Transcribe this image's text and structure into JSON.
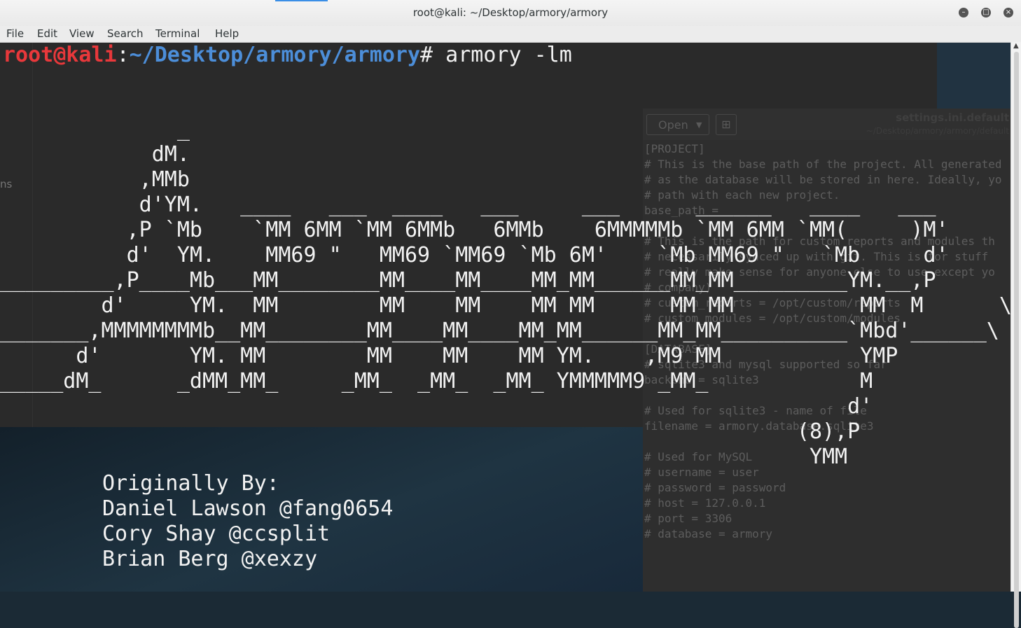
{
  "window": {
    "title": "root@kali: ~/Desktop/armory/armory",
    "controls": [
      "minimize",
      "maximize",
      "close"
    ]
  },
  "menubar": {
    "items": [
      "File",
      "Edit",
      "View",
      "Search",
      "Terminal",
      "Help"
    ]
  },
  "terminal": {
    "prompt": {
      "user_host": "root@kali",
      "colon": ":",
      "path": "~/Desktop/armory/armory",
      "symbol": "#",
      "command": " armory -lm"
    },
    "ascii_art": [
      "              _",
      "            dM.",
      "           ,MMb",
      "           d'YM.   ____   ___  ____   ___     ___      ______   ____   ___",
      "          ,P `Mb    `MM 6MM `MM 6MMb   6MMb    6MMMMMb `MM 6MM `MM(     )M'",
      "          d'  YM.    MM69 \"   MM69 `MM69 `Mb 6M'    `Mb MM69 \"   `Mb     d'",
      "_________,P____Mb___MM________MM____MM____MM_MM______MM_MM_________YM.__,P",
      "        d'     YM.  MM        MM    MM    MM MM      MM MM          MM  M      \\",
      "_______,MMMMMMMMb__MM________MM____MM____MM_MM______MM_MM__________`Mbd'______\\",
      "      d'       YM. MM        MM    MM    MM YM.    ,M9 MM           YMP",
      "_____dM_      _dMM_MM_     _MM_  _MM_  _MM_ YMMMMM9 _MM_            M",
      "                                                                   d'",
      "                                                               (8),P",
      "                                                                YMM"
    ],
    "credits": [
      "Originally By:",
      "Daniel Lawson @fang0654",
      "Cory Shay @ccsplit",
      "Brian Berg @xexzy"
    ],
    "background_sidebar_fragment": "ns"
  },
  "editor_behind": {
    "open_button": "Open",
    "filename": "settings.ini.default",
    "path": "~/Desktop/armory/armory/default",
    "lines": [
      "[PROJECT]",
      "# This is the base path of the project. All generated",
      "# as the database will be stored in here. Ideally, yo",
      "# path with each new project.",
      "base_path = ",
      "",
      "# This is the path for custom reports and modules th",
      "# necessarily synced up with git. This is for stuff",
      "# really make sense for anyone else to use except yo",
      "# company)",
      "# custom_reports = /opt/custom/reports",
      "# custom_modules = /opt/custom/modules",
      "",
      "[DATABASE]",
      "# sqlite3 and mysql supported so far",
      "backend = sqlite3",
      "",
      "# Used for sqlite3 - name of file",
      "filename = armory.database.sqlite3",
      "",
      "# Used for MySQL",
      "# username = user",
      "# password = password",
      "# host = 127.0.0.1",
      "# port = 3306",
      "# database = armory"
    ]
  },
  "colors": {
    "prompt_user": "#e8383b",
    "prompt_path": "#4c8ed9",
    "terminal_text": "#f2f2f2"
  }
}
